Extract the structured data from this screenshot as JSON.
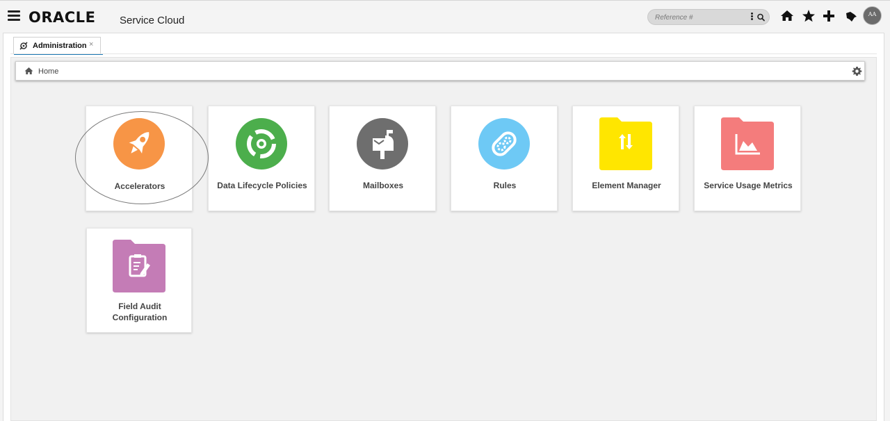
{
  "header": {
    "logo_text": "ORACLE",
    "product_name": "Service Cloud",
    "search_placeholder": "Reference #",
    "avatar_initials": "AA"
  },
  "tabs": [
    {
      "label": "Administration",
      "close": "×"
    }
  ],
  "breadcrumb": {
    "home_label": "Home"
  },
  "cards": [
    {
      "label": "Accelerators",
      "color": "#f79546",
      "icon": "rocket-icon"
    },
    {
      "label": "Data Lifecycle Policies",
      "color": "#4cae4c",
      "icon": "cycle-icon"
    },
    {
      "label": "Mailboxes",
      "color": "#6e6e6e",
      "icon": "mailbox-icon"
    },
    {
      "label": "Rules",
      "color": "#6ec9f5",
      "icon": "gear-pill-icon"
    },
    {
      "label": "Element Manager",
      "color": "#ffe600",
      "icon": "up-down-arrows-icon"
    },
    {
      "label": "Service Usage Metrics",
      "color": "#f47c7c",
      "icon": "area-chart-icon"
    },
    {
      "label_line1": "Field Audit",
      "label_line2": "Configuration",
      "color": "#c47cb6",
      "icon": "clipboard-icon"
    }
  ],
  "colors": {
    "accent": "#1d7ab6"
  }
}
